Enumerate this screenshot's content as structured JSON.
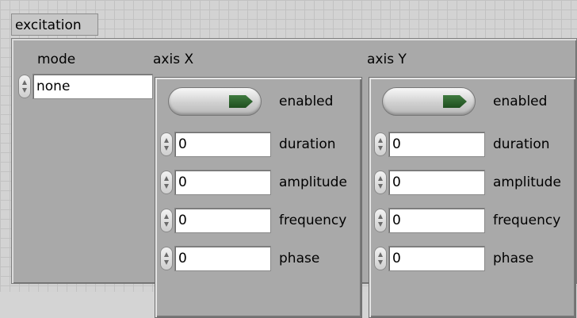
{
  "cluster": {
    "label": "excitation"
  },
  "mode": {
    "label": "mode",
    "value": "none"
  },
  "axis_x": {
    "label": "axis X",
    "enabled_label": "enabled",
    "enabled": true,
    "fields": [
      {
        "label": "duration",
        "value": "0"
      },
      {
        "label": "amplitude",
        "value": "0"
      },
      {
        "label": "frequency",
        "value": "0"
      },
      {
        "label": "phase",
        "value": "0"
      }
    ]
  },
  "axis_y": {
    "label": "axis Y",
    "enabled_label": "enabled",
    "enabled": true,
    "fields": [
      {
        "label": "duration",
        "value": "0"
      },
      {
        "label": "amplitude",
        "value": "0"
      },
      {
        "label": "frequency",
        "value": "0"
      },
      {
        "label": "phase",
        "value": "0"
      }
    ]
  },
  "colors": {
    "led_on": "#2f6a2f",
    "panel": "#a9a9a9"
  }
}
